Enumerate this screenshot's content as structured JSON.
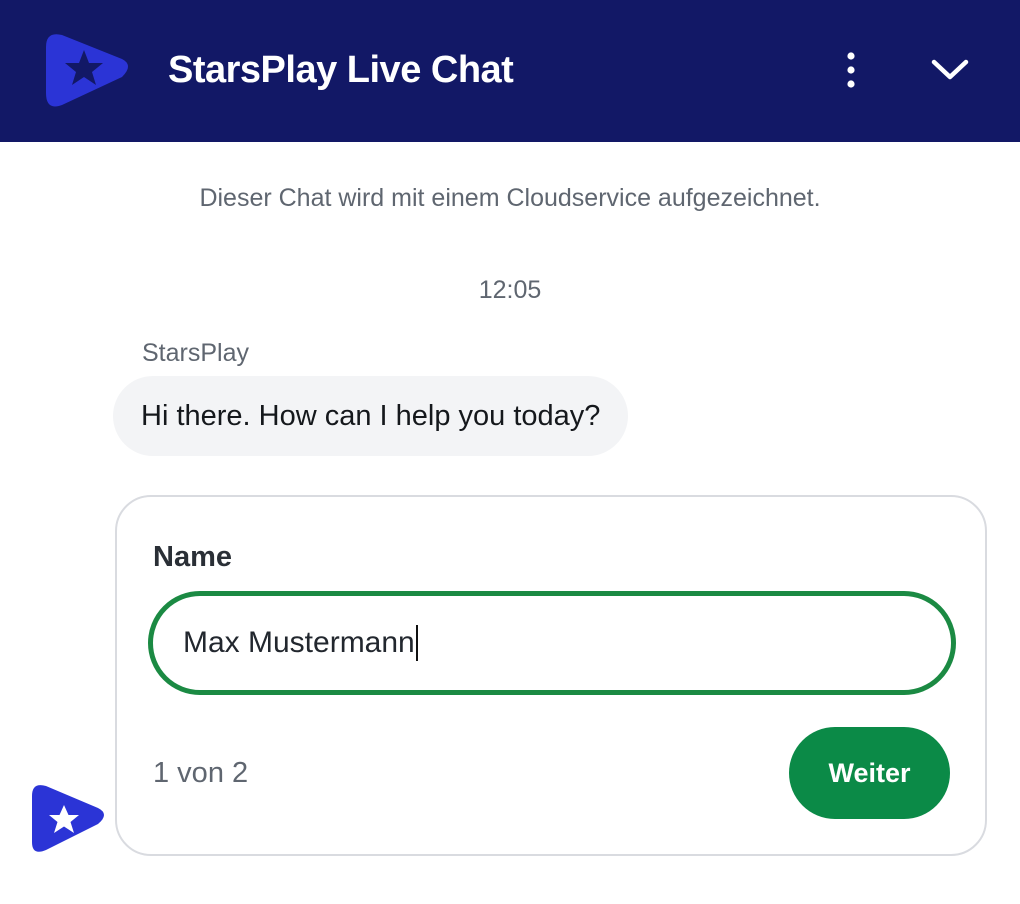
{
  "header": {
    "logo_icon": "starsplay-logo-icon",
    "title": "StarsPlay Live Chat",
    "menu_icon": "more-vertical-icon",
    "collapse_icon": "chevron-down-icon",
    "background_color": "#121866"
  },
  "chat": {
    "recording_notice": "Dieser Chat wird mit einem Cloudservice aufgezeichnet.",
    "timestamp": "12:05",
    "messages": [
      {
        "sender": "StarsPlay",
        "text": "Hi there. How can I help you today?"
      }
    ]
  },
  "form": {
    "field_label": "Name",
    "field_value": "Max Mustermann",
    "step_text": "1 von 2",
    "next_label": "Weiter",
    "accent_color": "#0b8a47"
  },
  "avatar": {
    "icon": "starsplay-avatar-icon",
    "brand_color": "#2b34d6"
  }
}
